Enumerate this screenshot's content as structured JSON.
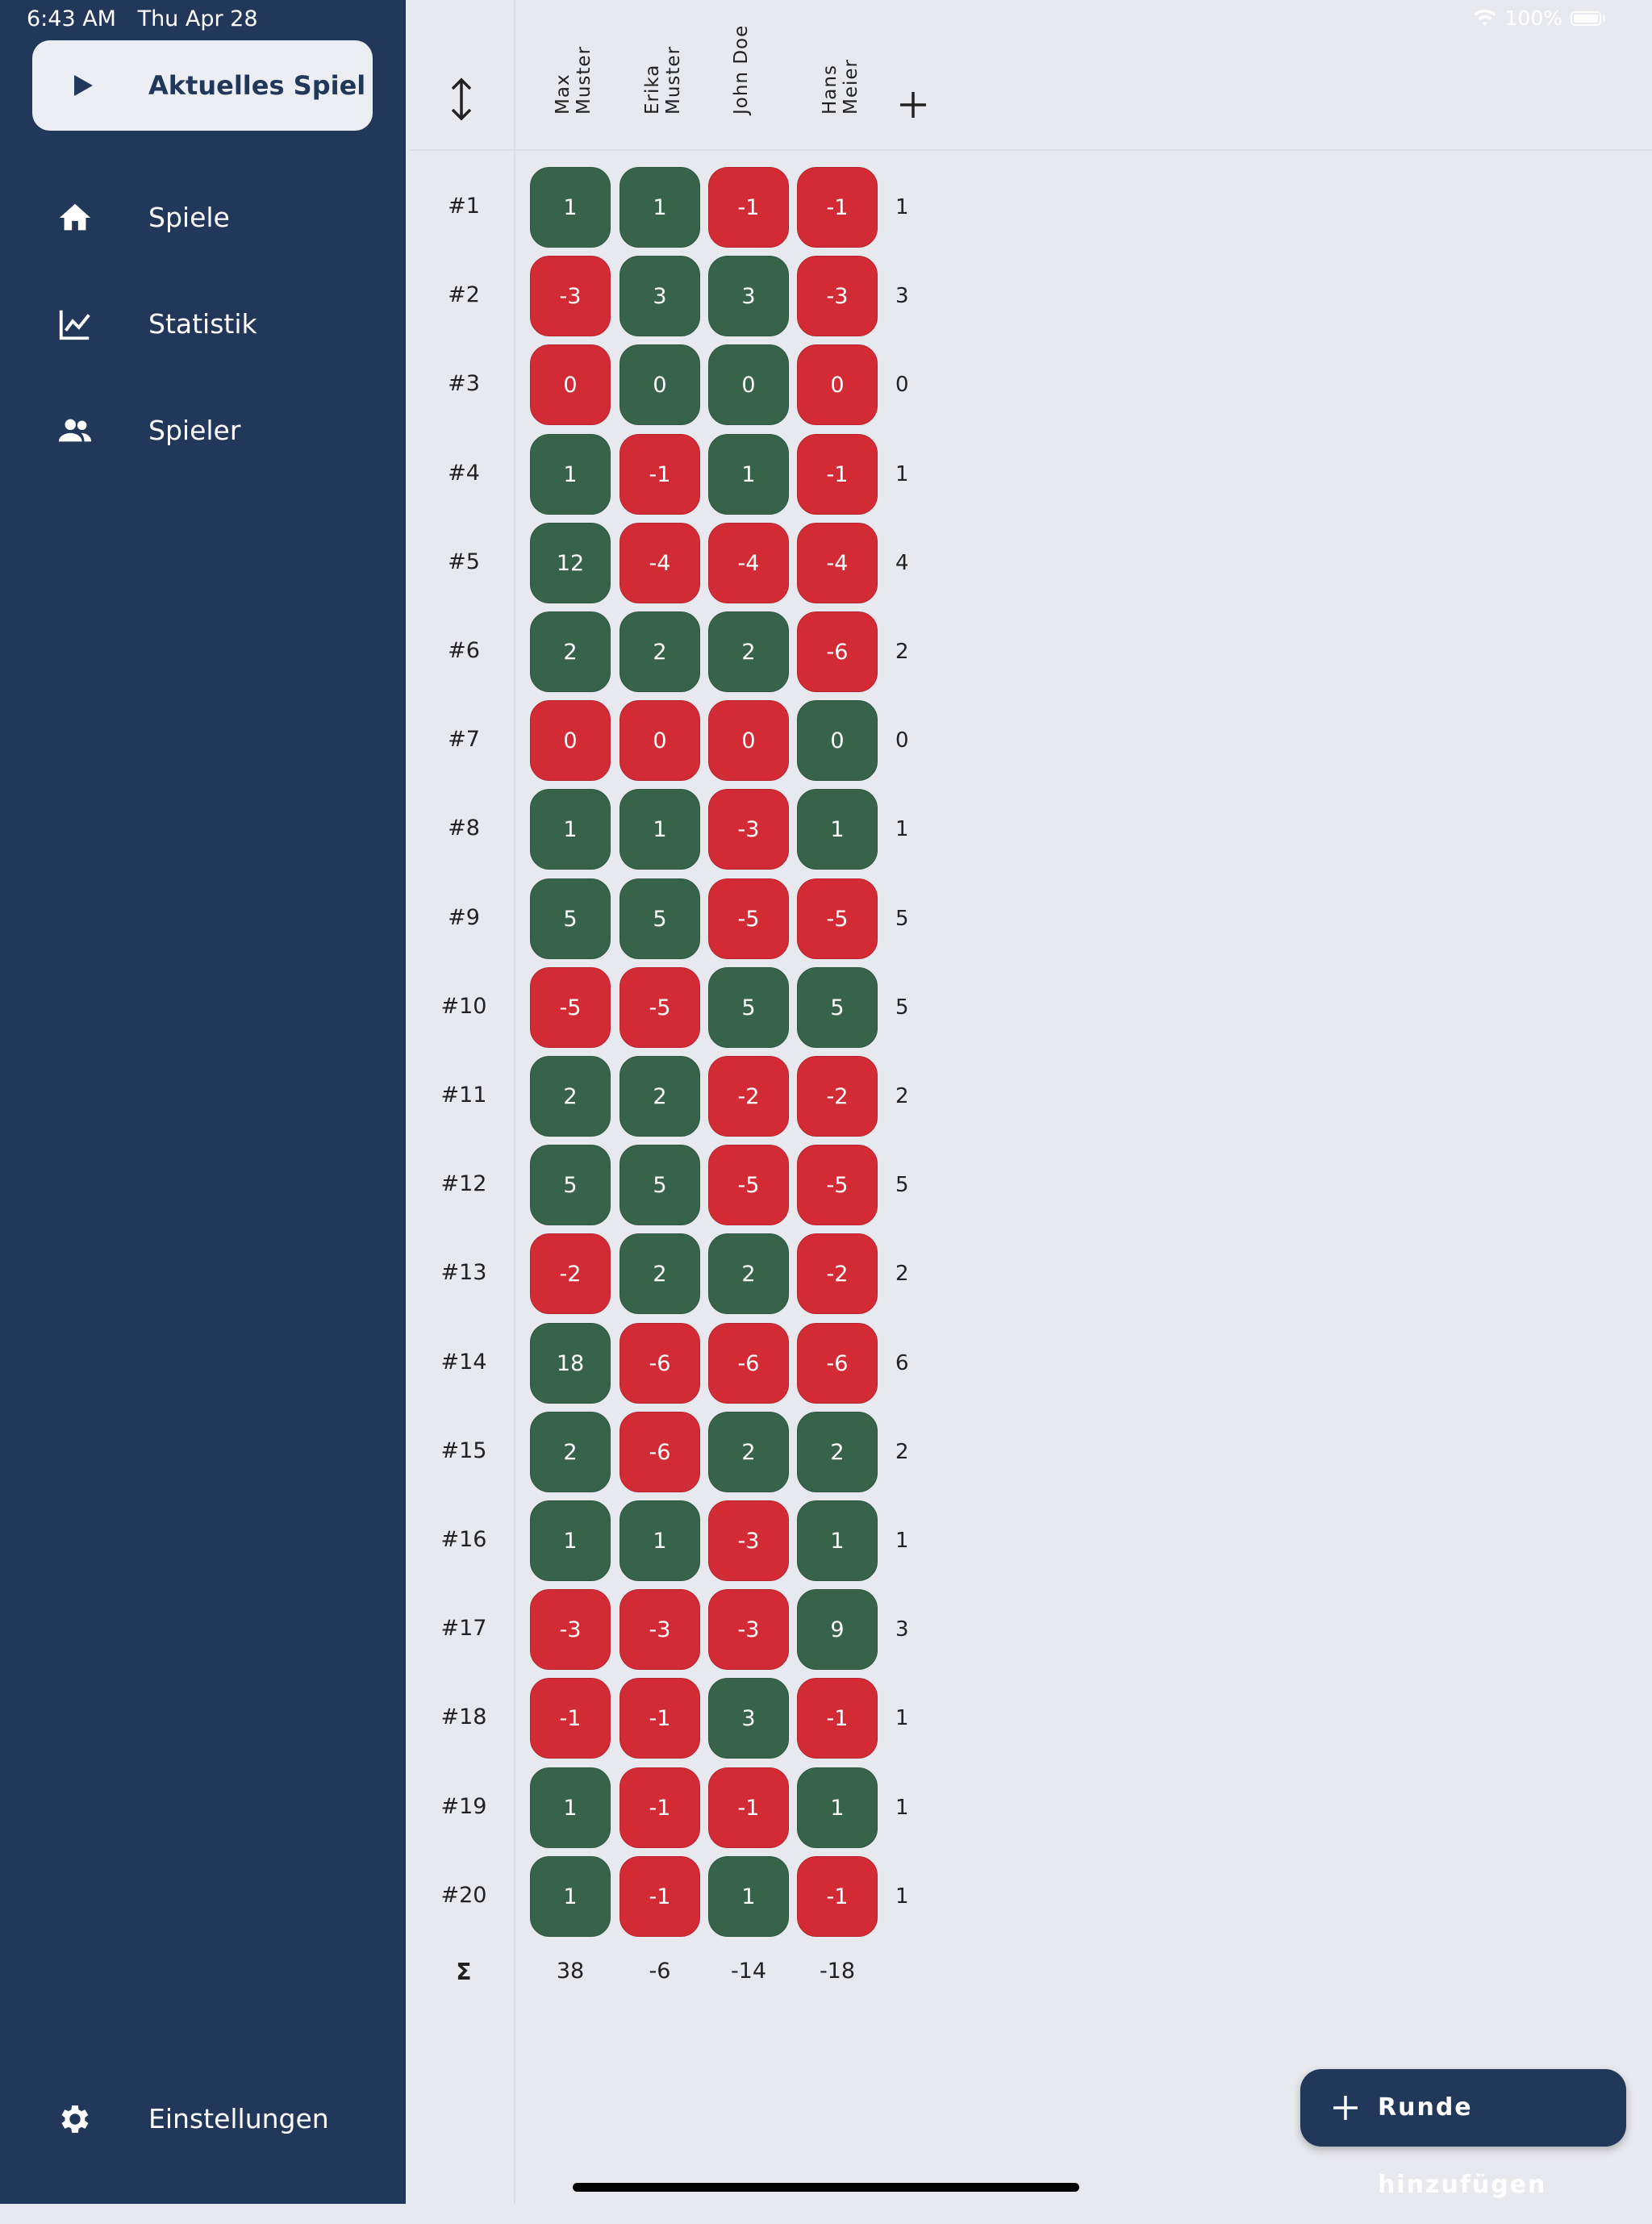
{
  "status_bar": {
    "time": "6:43 AM",
    "date": "Thu Apr 28",
    "battery": "100%"
  },
  "sidebar": {
    "current_game_label": "Aktuelles Spiel",
    "items": [
      {
        "label": "Spiele",
        "icon": "home-icon"
      },
      {
        "label": "Statistik",
        "icon": "chart-line-icon"
      },
      {
        "label": "Spieler",
        "icon": "people-icon"
      }
    ],
    "settings_label": "Einstellungen"
  },
  "players": [
    {
      "name": "Max\nMuster"
    },
    {
      "name": "Erika\nMuster"
    },
    {
      "name": "John Doe"
    },
    {
      "name": "Hans\nMeier"
    }
  ],
  "rounds": [
    {
      "label": "#1",
      "scores": [
        1,
        1,
        -1,
        -1
      ],
      "bid": "1"
    },
    {
      "label": "#2",
      "scores": [
        -3,
        3,
        3,
        -3
      ],
      "bid": "3"
    },
    {
      "label": "#3",
      "scores": [
        0,
        0,
        0,
        0
      ],
      "bid": "0",
      "winners": [
        false,
        true,
        true,
        false
      ]
    },
    {
      "label": "#4",
      "scores": [
        1,
        -1,
        1,
        -1
      ],
      "bid": "1"
    },
    {
      "label": "#5",
      "scores": [
        12,
        -4,
        -4,
        -4
      ],
      "bid": "4"
    },
    {
      "label": "#6",
      "scores": [
        2,
        2,
        2,
        -6
      ],
      "bid": "2"
    },
    {
      "label": "#7",
      "scores": [
        0,
        0,
        0,
        0
      ],
      "bid": "0",
      "winners": [
        false,
        false,
        false,
        true
      ]
    },
    {
      "label": "#8",
      "scores": [
        1,
        1,
        -3,
        1
      ],
      "bid": "1"
    },
    {
      "label": "#9",
      "scores": [
        5,
        5,
        -5,
        -5
      ],
      "bid": "5"
    },
    {
      "label": "#10",
      "scores": [
        -5,
        -5,
        5,
        5
      ],
      "bid": "5"
    },
    {
      "label": "#11",
      "scores": [
        2,
        2,
        -2,
        -2
      ],
      "bid": "2"
    },
    {
      "label": "#12",
      "scores": [
        5,
        5,
        -5,
        -5
      ],
      "bid": "5"
    },
    {
      "label": "#13",
      "scores": [
        -2,
        2,
        2,
        -2
      ],
      "bid": "2"
    },
    {
      "label": "#14",
      "scores": [
        18,
        -6,
        -6,
        -6
      ],
      "bid": "6"
    },
    {
      "label": "#15",
      "scores": [
        2,
        -6,
        2,
        2
      ],
      "bid": "2"
    },
    {
      "label": "#16",
      "scores": [
        1,
        1,
        -3,
        1
      ],
      "bid": "1"
    },
    {
      "label": "#17",
      "scores": [
        -3,
        -3,
        -3,
        9
      ],
      "bid": "3"
    },
    {
      "label": "#18",
      "scores": [
        -1,
        -1,
        3,
        -1
      ],
      "bid": "1"
    },
    {
      "label": "#19",
      "scores": [
        1,
        -1,
        -1,
        1
      ],
      "bid": "1"
    },
    {
      "label": "#20",
      "scores": [
        1,
        -1,
        1,
        -1
      ],
      "bid": "1"
    }
  ],
  "totals": {
    "label": "Σ",
    "values": [
      "38",
      "-6",
      "-14",
      "-18"
    ]
  },
  "fab": {
    "label": "Runde hinzufügen"
  },
  "colors": {
    "sidebar": "#22385b",
    "win": "#38634b",
    "loss": "#d32b36",
    "background": "#e8e9ee"
  }
}
